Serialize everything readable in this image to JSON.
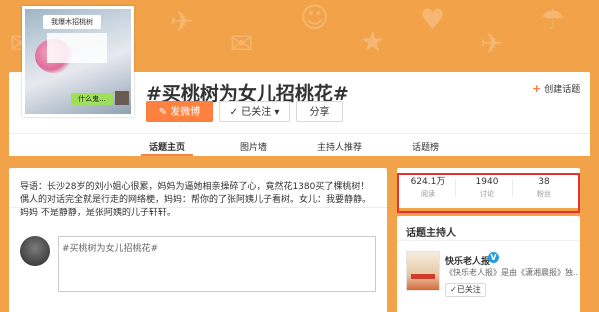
{
  "colors": {
    "accent": "#ff8140",
    "highlight": "#e8322e",
    "background": "#f2a349",
    "verified": "#1c9fea"
  },
  "cover": {
    "bubble_top": "我爆木招桃树",
    "bubble_bottom": "什么鬼..."
  },
  "topic": {
    "title": "#买桃树为女儿招桃花#",
    "create_link": "创建话题",
    "post_button": "发微博",
    "follow_button": "已关注",
    "share_button": "分享"
  },
  "tabs": [
    {
      "label": "话题主页",
      "active": true
    },
    {
      "label": "图片墙",
      "active": false
    },
    {
      "label": "主持人推荐",
      "active": false
    },
    {
      "label": "话题榜",
      "active": false
    }
  ],
  "intro": {
    "text": "导语：长沙28岁的刘小姐心很累，妈妈为逼她相亲操碎了心，竟然花1380买了棵桃树！偶人的对话完全就是行走的网络梗，妈妈：帮你的了张阿姨儿子看树。女儿：我要静静。妈妈 不是静静，是张阿姨的儿子轩轩。"
  },
  "composer": {
    "text": "#买桃树为女儿招桃花#"
  },
  "stats": [
    {
      "value": "624.1万",
      "label": "阅读"
    },
    {
      "value": "1940",
      "label": "讨论"
    },
    {
      "value": "38",
      "label": "粉丝"
    }
  ],
  "host": {
    "section_title": "话题主持人",
    "name": "快乐老人报",
    "verified_mark": "V",
    "description": "《快乐老人报》是由《潇湘晨报》独...",
    "follow_label": "已关注"
  },
  "icons": [
    "plus-icon",
    "edit-icon",
    "check-icon",
    "chevron-down-icon",
    "verified-icon"
  ]
}
